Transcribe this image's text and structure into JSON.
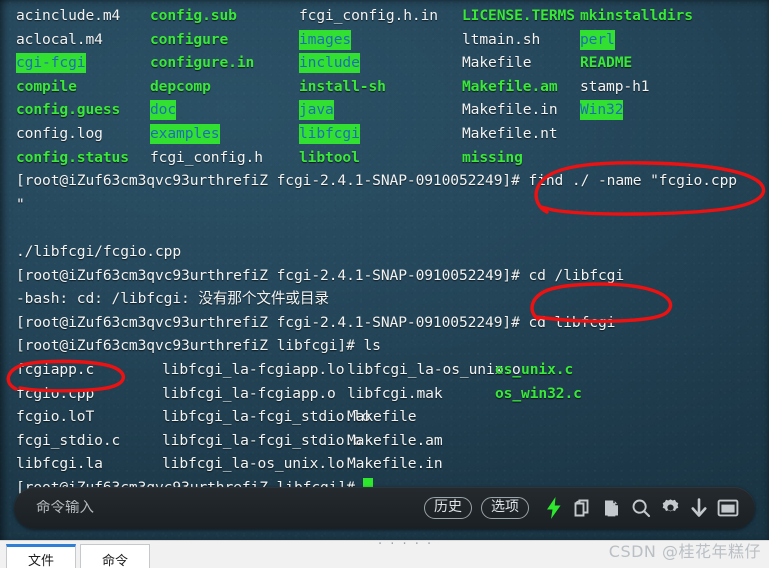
{
  "terminal": {
    "prompt_root": "[root@iZuf63cm3qvc93urthrefiZ fcgi-2.4.1-SNAP-0910052249]# ",
    "prompt_libfcgi": "[root@iZuf63cm3qvc93urthrefiZ libfcgi]# ",
    "cmd_find": "find ./ -name \"fcgio.cpp",
    "cmd_find_cont": "\"",
    "find_result": "./libfcgi/fcgio.cpp",
    "cmd_cd_abs": "cd /libfcgi",
    "cd_error": "-bash: cd: /libfcgi: 没有那个文件或目录",
    "cmd_cd_rel": "cd libfcgi",
    "cmd_ls": "ls",
    "listing_top": [
      [
        {
          "text": "acinclude.m4",
          "type": "plain"
        },
        {
          "text": "config.sub",
          "type": "exec"
        },
        {
          "text": "fcgi_config.h.in",
          "type": "plain"
        },
        {
          "text": "LICENSE.TERMS",
          "type": "exec"
        },
        {
          "text": "mkinstalldirs",
          "type": "exec"
        }
      ],
      [
        {
          "text": "aclocal.m4",
          "type": "plain"
        },
        {
          "text": "configure",
          "type": "exec"
        },
        {
          "text": "images",
          "type": "dir"
        },
        {
          "text": "ltmain.sh",
          "type": "plain"
        },
        {
          "text": "perl",
          "type": "dir"
        }
      ],
      [
        {
          "text": "cgi-fcgi",
          "type": "dir"
        },
        {
          "text": "configure.in",
          "type": "exec"
        },
        {
          "text": "include",
          "type": "dir"
        },
        {
          "text": "Makefile",
          "type": "plain"
        },
        {
          "text": "README",
          "type": "exec"
        }
      ],
      [
        {
          "text": "compile",
          "type": "exec"
        },
        {
          "text": "depcomp",
          "type": "exec"
        },
        {
          "text": "install-sh",
          "type": "exec"
        },
        {
          "text": "Makefile.am",
          "type": "exec"
        },
        {
          "text": "stamp-h1",
          "type": "plain"
        }
      ],
      [
        {
          "text": "config.guess",
          "type": "exec"
        },
        {
          "text": "doc",
          "type": "dir"
        },
        {
          "text": "java",
          "type": "dir"
        },
        {
          "text": "Makefile.in",
          "type": "plain"
        },
        {
          "text": "Win32",
          "type": "dir"
        }
      ],
      [
        {
          "text": "config.log",
          "type": "plain"
        },
        {
          "text": "examples",
          "type": "dir"
        },
        {
          "text": "libfcgi",
          "type": "dir"
        },
        {
          "text": "Makefile.nt",
          "type": "plain"
        },
        {
          "text": "",
          "type": "plain"
        }
      ],
      [
        {
          "text": "config.status",
          "type": "exec"
        },
        {
          "text": "fcgi_config.h",
          "type": "plain"
        },
        {
          "text": "libtool",
          "type": "exec"
        },
        {
          "text": "missing",
          "type": "exec"
        },
        {
          "text": "",
          "type": "plain"
        }
      ]
    ],
    "listing_libfcgi": [
      [
        {
          "text": "fcgiapp.c",
          "type": "plain"
        },
        {
          "text": "libfcgi_la-fcgiapp.lo",
          "type": "plain"
        },
        {
          "text": "libfcgi_la-os_unix.o",
          "type": "plain"
        },
        {
          "text": "os_unix.c",
          "type": "exec"
        }
      ],
      [
        {
          "text": "fcgio.cpp",
          "type": "plain"
        },
        {
          "text": "libfcgi_la-fcgiapp.o",
          "type": "plain"
        },
        {
          "text": "libfcgi.mak",
          "type": "plain"
        },
        {
          "text": "os_win32.c",
          "type": "exec"
        }
      ],
      [
        {
          "text": "fcgio.loT",
          "type": "plain"
        },
        {
          "text": "libfcgi_la-fcgi_stdio.lo",
          "type": "plain"
        },
        {
          "text": "Makefile",
          "type": "plain"
        },
        {
          "text": "",
          "type": "plain"
        }
      ],
      [
        {
          "text": "fcgi_stdio.c",
          "type": "plain"
        },
        {
          "text": "libfcgi_la-fcgi_stdio.o",
          "type": "plain"
        },
        {
          "text": "Makefile.am",
          "type": "plain"
        },
        {
          "text": "",
          "type": "plain"
        }
      ],
      [
        {
          "text": "libfcgi.la",
          "type": "plain"
        },
        {
          "text": "libfcgi_la-os_unix.lo",
          "type": "plain"
        },
        {
          "text": "Makefile.in",
          "type": "plain"
        },
        {
          "text": "",
          "type": "plain"
        }
      ]
    ]
  },
  "annotations": {
    "color": "#ee1111",
    "marks": [
      {
        "name": "circle-find-command",
        "target": "find ./ -name \"fcgio.cpp"
      },
      {
        "name": "circle-cd-libfcgi",
        "target": "cd libfcgi"
      },
      {
        "name": "circle-fcgio-cpp",
        "target": "fcgio.cpp"
      }
    ]
  },
  "command_bar": {
    "input_placeholder": "命令输入",
    "input_value": "",
    "history_label": "历史",
    "options_label": "选项",
    "icons": [
      {
        "name": "lightning-icon",
        "color": "#2ee82e"
      },
      {
        "name": "copy-icon",
        "color": "#c3c9cd"
      },
      {
        "name": "paste-icon",
        "color": "#c3c9cd"
      },
      {
        "name": "search-icon",
        "color": "#c3c9cd"
      },
      {
        "name": "gear-icon",
        "color": "#c3c9cd"
      },
      {
        "name": "download-icon",
        "color": "#c3c9cd"
      },
      {
        "name": "window-icon",
        "color": "#c3c9cd"
      }
    ]
  },
  "footer": {
    "tabs": [
      {
        "label": "文件",
        "active": true
      },
      {
        "label": "命令",
        "active": false
      }
    ],
    "dots": "· · · · ·",
    "watermark": "CSDN @桂花年糕仔"
  },
  "colors": {
    "terminal_bg": "#26485c",
    "dir_highlight": "#32e032",
    "dir_text": "#1f6fb0",
    "exec_text": "#3ae83a",
    "plain_text": "#f2f4f4",
    "cursor": "#2ee82e",
    "annotation_red": "#ee1111"
  }
}
